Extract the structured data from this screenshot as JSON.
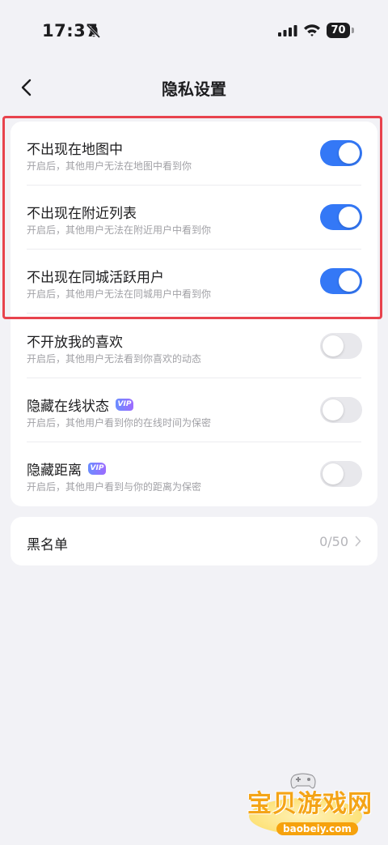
{
  "status_bar": {
    "time": "17:37",
    "battery": "70"
  },
  "nav": {
    "title": "隐私设置",
    "back_icon": "chevron-left-icon"
  },
  "settings": [
    {
      "title": "不出现在地图中",
      "subtitle": "开启后，其他用户无法在地图中看到你",
      "enabled": true,
      "vip": false
    },
    {
      "title": "不出现在附近列表",
      "subtitle": "开启后，其他用户无法在附近用户中看到你",
      "enabled": true,
      "vip": false
    },
    {
      "title": "不出现在同城活跃用户",
      "subtitle": "开启后，其他用户无法在同城用户中看到你",
      "enabled": true,
      "vip": false
    },
    {
      "title": "不开放我的喜欢",
      "subtitle": "开启后，其他用户无法看到你喜欢的动态",
      "enabled": false,
      "vip": false
    },
    {
      "title": "隐藏在线状态",
      "subtitle": "开启后，其他用户看到你的在线时间为保密",
      "enabled": false,
      "vip": true
    },
    {
      "title": "隐藏距离",
      "subtitle": "开启后，其他用户看到与你的距离为保密",
      "enabled": false,
      "vip": true
    }
  ],
  "vip_badge": "VIP",
  "blacklist": {
    "label": "黑名单",
    "count": "0/50"
  },
  "watermark": {
    "text": "宝贝游戏网",
    "domain": "baobeiy.com"
  },
  "colors": {
    "accent": "#3478f6",
    "highlight": "#e8434d",
    "background": "#f2f2f6"
  }
}
